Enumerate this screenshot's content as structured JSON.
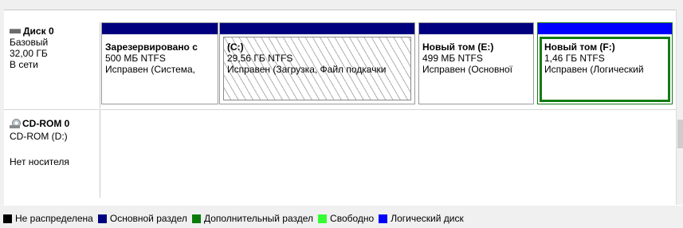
{
  "colors": {
    "unallocated": "#000000",
    "primary": "#00007f",
    "extended": "#0a7b0a",
    "free": "#33ff33",
    "logical": "#0000ff",
    "selection": "#117c12"
  },
  "disks": [
    {
      "name": "Диск 0",
      "icon": "hard-disk-icon",
      "type": "Базовый",
      "size": "32,00 ГБ",
      "status": "В сети",
      "partitions": [
        {
          "label": "Зарезервировано с",
          "size_fs": "500 МБ NTFS",
          "state": "Исправен (Система,",
          "kind": "primary"
        },
        {
          "label": "(C:)",
          "size_fs": "29,56 ГБ NTFS",
          "state": "Исправен (Загрузка, Файл подкачки",
          "kind": "primary",
          "pattern": "hatched"
        },
        {
          "label": "Новый том  (E:)",
          "size_fs": "499 МБ NTFS",
          "state": "Исправен (Основної",
          "kind": "primary"
        },
        {
          "label": "Новый том  (F:)",
          "size_fs": "1,46 ГБ NTFS",
          "state": "Исправен (Логический",
          "kind": "logical",
          "selected": true
        }
      ]
    },
    {
      "name": "CD-ROM 0",
      "icon": "cd-rom-icon",
      "type": "CD-ROM (D:)",
      "status": "Нет носителя"
    }
  ],
  "legend": [
    {
      "label": "Не распределена",
      "color": "#000000"
    },
    {
      "label": "Основной раздел",
      "color": "#00007f"
    },
    {
      "label": "Дополнительный раздел",
      "color": "#0a7b0a"
    },
    {
      "label": "Свободно",
      "color": "#33ff33"
    },
    {
      "label": "Логический диск",
      "color": "#0000ff"
    }
  ]
}
